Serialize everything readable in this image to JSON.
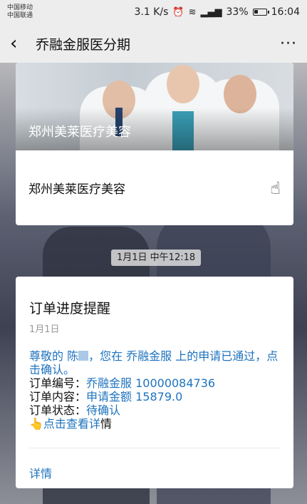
{
  "status_bar": {
    "carrier_1": "中国移动",
    "carrier_2": "中国联通",
    "speed": "3.1 K/s",
    "battery": "33%",
    "time": "16:04"
  },
  "nav": {
    "title": "乔融金服医分期",
    "more": "···"
  },
  "link_card": {
    "banner_title": "郑州美莱医疗美容",
    "text": "郑州美莱医疗美容"
  },
  "time_label": "1月1日 中午12:18",
  "message": {
    "title": "订单进度提醒",
    "date": "1月1日",
    "greeting": "尊敬的 陈",
    "greeting_rest": "，您在 乔融金服 上的申请已通过，点击确认。",
    "order_no_label": "订单编号：",
    "order_no": "乔融金服 10000084736",
    "order_content_label": "订单内容：",
    "order_content": "申请金额 15879.0",
    "order_status_label": "订单状态：",
    "order_status": "待确认",
    "view_detail_link": "点击查看详",
    "view_detail_tail": "情",
    "details_link": "详情"
  },
  "colors": {
    "link_blue": "#1e73be",
    "nav_bg": "#ededed"
  },
  "icons": [
    "back-arrow",
    "more-dots",
    "alarm",
    "wifi",
    "signal",
    "battery",
    "hand-tap",
    "pointing-finger"
  ]
}
